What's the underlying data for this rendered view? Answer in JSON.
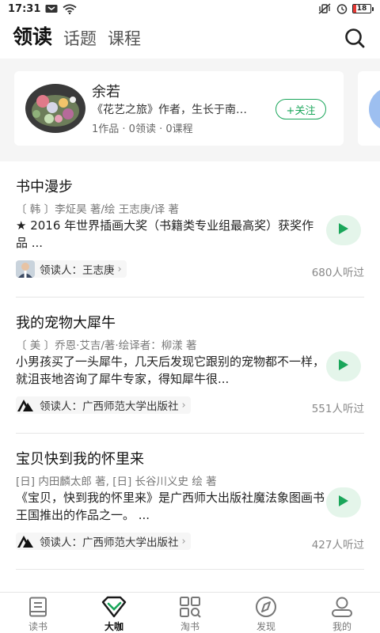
{
  "status_bar": {
    "time": "17:31",
    "battery": "18",
    "battery_level": 0.18
  },
  "header": {
    "tabs": [
      {
        "label": "领读",
        "active": true
      },
      {
        "label": "话题",
        "active": false
      },
      {
        "label": "课程",
        "active": false
      }
    ],
    "search_icon": "search-icon"
  },
  "author_card": {
    "name": "余若",
    "desc": "《花艺之旅》作者，生长于南…",
    "stats": "1作品 · 0领读 · 0课程",
    "follow_label": "+关注"
  },
  "books": [
    {
      "title": "书中漫步",
      "author": "〔 韩 〕李炡昊 著/绘     王志庚/译 著",
      "desc": "★ 2016 年世界插画大奖（书籍类专业组最高奖）获奖作品 ...",
      "reader": "领读人：王志庚",
      "listens": "680人听过",
      "reader_icon": "person-avatar"
    },
    {
      "title": "我的宠物大犀牛",
      "author": "〔 美 〕乔恩·艾吉/著·绘译者：柳漾 著",
      "desc": "    小男孩买了一头犀牛，几天后发现它跟别的宠物都不一样，就沮丧地咨询了犀牛专家，得知犀牛很...",
      "reader": "领读人：广西师范大学出版社",
      "listens": "551人听过",
      "reader_icon": "publisher-logo"
    },
    {
      "title": "宝贝快到我的怀里来",
      "author": "  [日] 内田麟太郎 著, [日] 长谷川义史 绘 著",
      "desc": "《宝贝，快到我的怀里来》是广西师大出版社魔法象图画书王国推出的作品之一。 ...",
      "reader": "领读人：广西师范大学出版社",
      "listens": "427人听过",
      "reader_icon": "publisher-logo"
    }
  ],
  "bottom_nav": [
    {
      "label": "读书",
      "icon": "book-icon",
      "active": false
    },
    {
      "label": "大咖",
      "icon": "heart-check-icon",
      "active": true
    },
    {
      "label": "淘书",
      "icon": "grid-search-icon",
      "active": false
    },
    {
      "label": "发现",
      "icon": "compass-icon",
      "active": false
    },
    {
      "label": "我的",
      "icon": "person-icon",
      "active": false
    }
  ],
  "colors": {
    "accent": "#1aa65a",
    "play_bg": "#e4f5ea",
    "strip_bg": "#f5f5f5",
    "peek_avatar": "#9dbff0"
  }
}
